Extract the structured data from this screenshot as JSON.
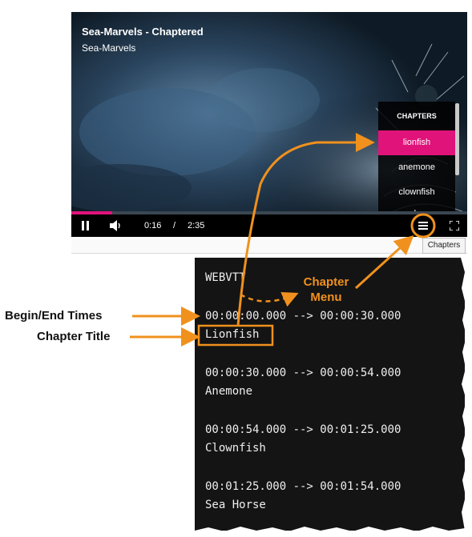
{
  "player": {
    "title": "Sea-Marvels - Chaptered",
    "subtitle": "Sea-Marvels",
    "current_time": "0:16",
    "separator": "/",
    "duration": "2:35",
    "progress_fraction": 0.103,
    "chapter_menu": {
      "header": "CHAPTERS",
      "items": [
        "lionfish",
        "anemone",
        "clownfish",
        "sea horse"
      ],
      "active_index": 0
    },
    "tooltip": "Chapters"
  },
  "vtt": {
    "header": "WEBVTT",
    "cues": [
      {
        "times": "00:00:00.000 --> 00:00:30.000",
        "title": "Lionfish"
      },
      {
        "times": "00:00:30.000 --> 00:00:54.000",
        "title": "Anemone"
      },
      {
        "times": "00:00:54.000 --> 00:01:25.000",
        "title": "Clownfish"
      },
      {
        "times": "00:01:25.000 --> 00:01:54.000",
        "title": "Sea Horse"
      }
    ]
  },
  "annotations": {
    "begin_end": "Begin/End Times",
    "chapter_title": "Chapter Title",
    "chapter_menu_line1": "Chapter",
    "chapter_menu_line2": "Menu"
  },
  "colors": {
    "accent": "#e0137b",
    "annotation": "#f0911d",
    "code_bg": "#141414"
  }
}
